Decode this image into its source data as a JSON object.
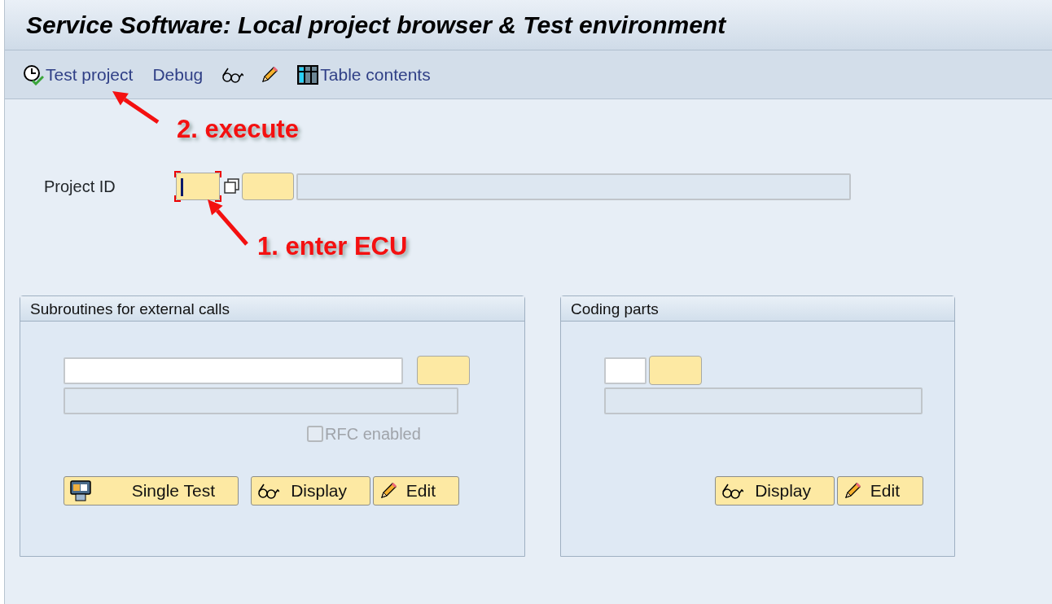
{
  "window": {
    "title": "Service Software: Local project browser & Test environment"
  },
  "toolbar": [
    {
      "kind": "execute",
      "label": "Test project"
    },
    {
      "kind": "text",
      "label": "Debug"
    },
    {
      "kind": "display"
    },
    {
      "kind": "edit"
    },
    {
      "kind": "table",
      "label": "Table contents"
    }
  ],
  "project_id": {
    "label": "Project ID",
    "focused": true
  },
  "groups": [
    {
      "kind": "wide",
      "title": "Subroutines for external calls",
      "checkbox": {
        "label": "RFC enabled",
        "checked": false,
        "disabled": true
      },
      "buttons": [
        {
          "kind": "test",
          "label": "Single Test"
        },
        {
          "kind": "display",
          "label": "Display"
        },
        {
          "kind": "edit",
          "label": "Edit"
        }
      ]
    },
    {
      "kind": "narrow",
      "title": "Coding parts",
      "buttons": [
        {
          "kind": "display",
          "label": "Display"
        },
        {
          "kind": "edit",
          "label": "Edit"
        }
      ]
    }
  ],
  "annotations": [
    {
      "text": "2. execute"
    },
    {
      "text": "1. enter ECU"
    }
  ]
}
